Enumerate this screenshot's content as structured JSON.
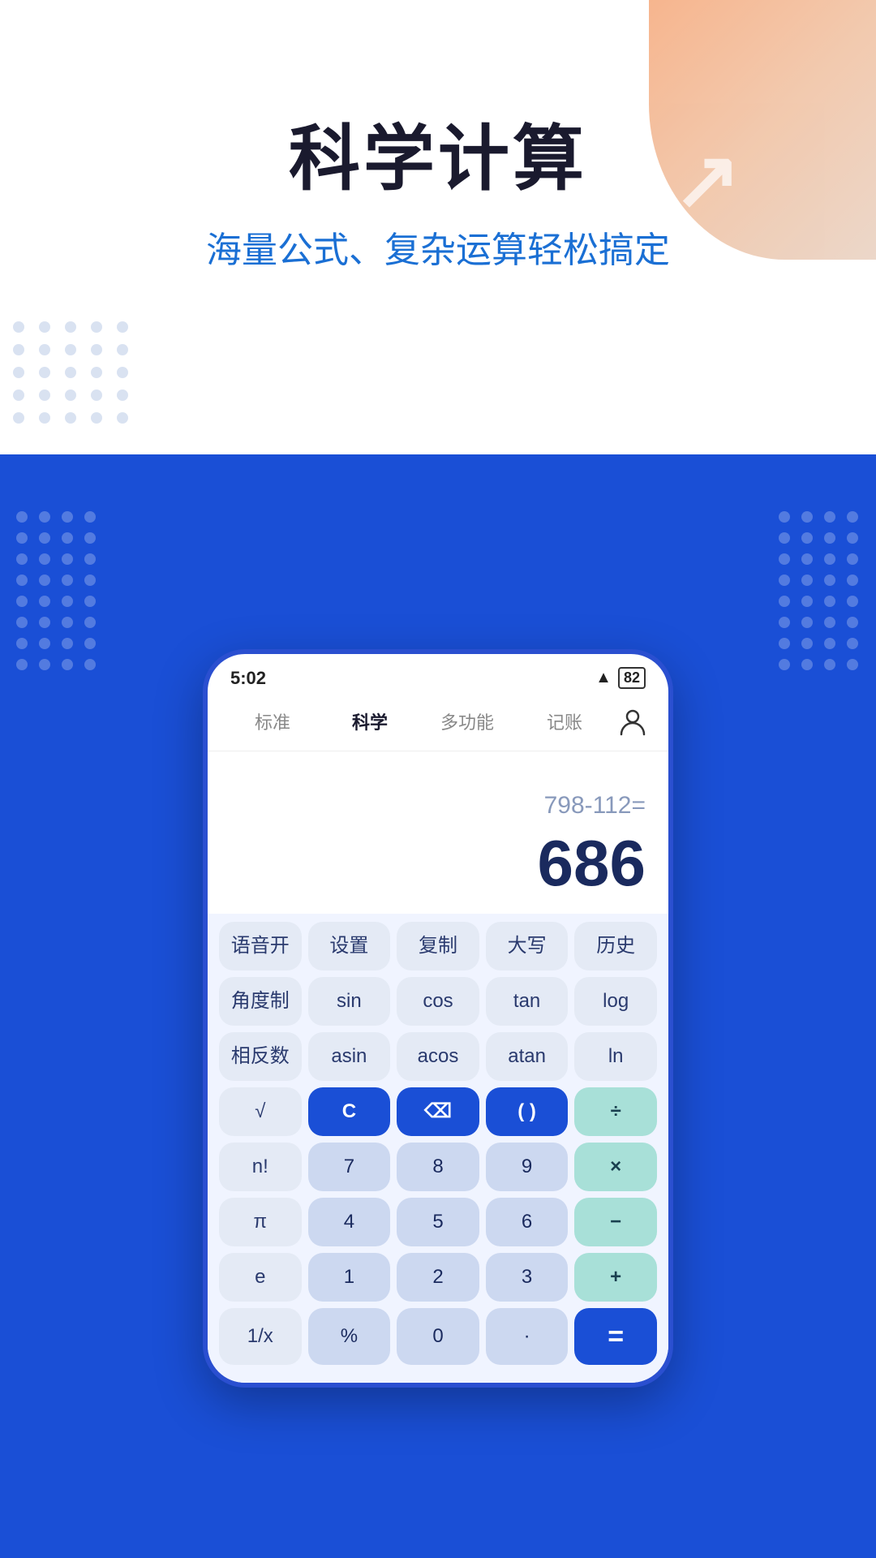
{
  "page": {
    "title": "科学计算",
    "subtitle": "海量公式、复杂运算轻松搞定"
  },
  "status_bar": {
    "time": "5:02",
    "battery": "82"
  },
  "nav": {
    "tabs": [
      {
        "label": "标准",
        "active": false
      },
      {
        "label": "科学",
        "active": true
      },
      {
        "label": "多功能",
        "active": false
      },
      {
        "label": "记账",
        "active": false
      }
    ]
  },
  "display": {
    "expression": "798-112=",
    "result": "686"
  },
  "buttons": {
    "row1": [
      "语音开",
      "设置",
      "复制",
      "大写",
      "历史"
    ],
    "row2": [
      "角度制",
      "sin",
      "cos",
      "tan",
      "log"
    ],
    "row3": [
      "相反数",
      "asin",
      "acos",
      "atan",
      "ln"
    ],
    "row4": [
      "√",
      "C",
      "⌫",
      "( )",
      "÷"
    ],
    "row5": [
      "n!",
      "7",
      "8",
      "9",
      "×"
    ],
    "row6": [
      "π",
      "4",
      "5",
      "6",
      "−"
    ],
    "row7": [
      "e",
      "1",
      "2",
      "3",
      "+"
    ],
    "row8": [
      "1/x",
      "%",
      "0",
      "·",
      "="
    ]
  }
}
